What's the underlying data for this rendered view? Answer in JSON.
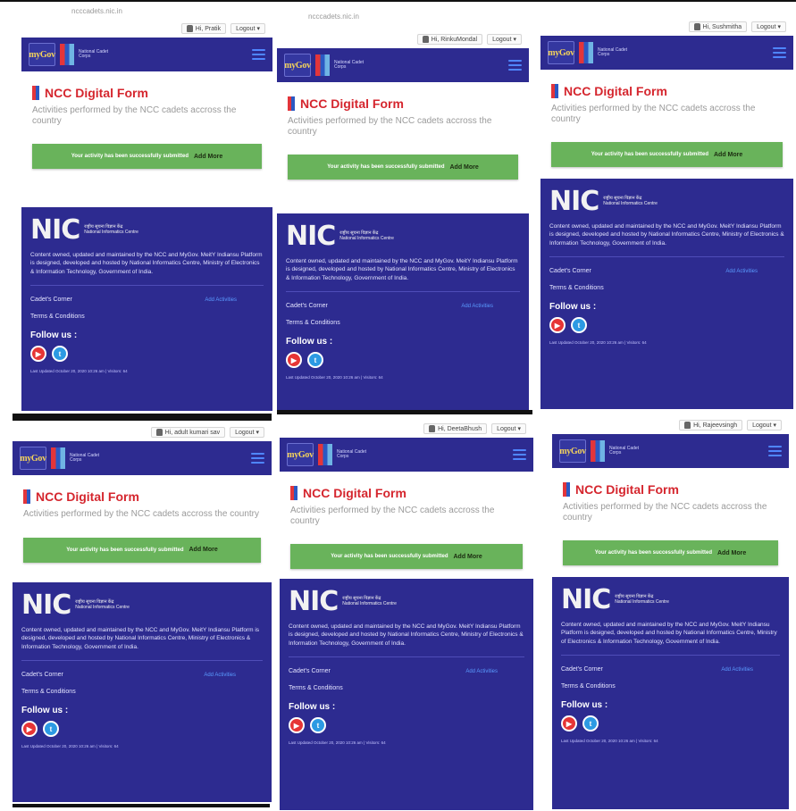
{
  "browser_hints": [
    "ncccadets.nic.in",
    "ncccadets.nic.in"
  ],
  "shared": {
    "logout_label": "Logout",
    "brand_mygov": "myGov",
    "brand_ncc": "National Cadet Corps",
    "form_title": "NCC Digital Form",
    "form_subtitle": "Activities performed by the NCC cadets accross the country",
    "success_text": "Your activity has been successfully submitted",
    "add_more_label": "Add More",
    "nic_big": "NIC",
    "nic_small_hi": "राष्ट्रीय सूचना विज्ञान केंद्र",
    "nic_small_en": "National Informatics Centre",
    "footer_desc": "Content owned, updated and maintained by the NCC and MyGov. MeitY Indiansu Platform is designed, developed and hosted by National Informatics Centre, Ministry of Electronics & Information Technology, Government of India.",
    "cadets_corner": "Cadet's Corner",
    "cadets_link": "Add Activities",
    "terms": "Terms & Conditions",
    "follow": "Follow us :",
    "updated": "Last Updated October 20, 2020 10:26 am | Visitors: 64"
  },
  "screens": [
    {
      "user": "Hi, Pratik"
    },
    {
      "user": "Hi, RinkuMondal"
    },
    {
      "user": "Hi, Sushmitha"
    },
    {
      "user": "Hi, adult kumari sav"
    },
    {
      "user": "Hi, DeetaBhush"
    },
    {
      "user": "Hi, Rajeevsingh"
    }
  ]
}
